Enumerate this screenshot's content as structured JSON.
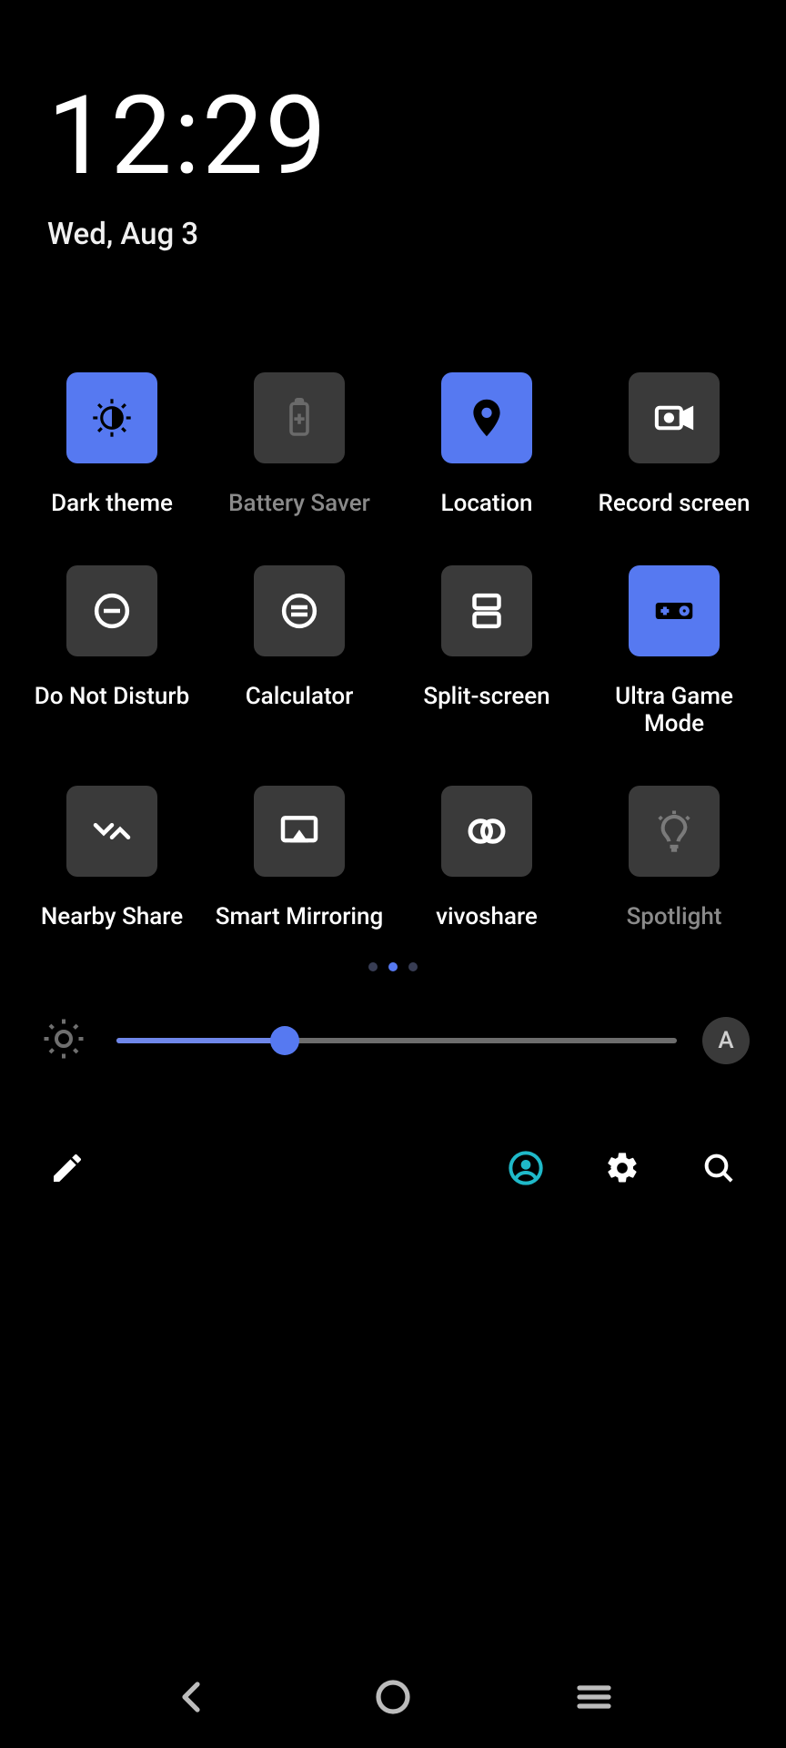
{
  "time": "12:29",
  "date": "Wed, Aug 3",
  "tiles": [
    {
      "label": "Dark theme",
      "on": true,
      "dim": false,
      "icon": "contrast"
    },
    {
      "label": "Battery Saver",
      "on": false,
      "dim": true,
      "icon": "battery"
    },
    {
      "label": "Location",
      "on": true,
      "dim": false,
      "icon": "pin"
    },
    {
      "label": "Record screen",
      "on": false,
      "dim": false,
      "icon": "camcorder"
    },
    {
      "label": "Do Not Disturb",
      "on": false,
      "dim": false,
      "icon": "dnd"
    },
    {
      "label": "Calculator",
      "on": false,
      "dim": false,
      "icon": "calc"
    },
    {
      "label": "Split-screen",
      "on": false,
      "dim": false,
      "icon": "split"
    },
    {
      "label": "Ultra Game Mode",
      "on": true,
      "dim": false,
      "icon": "game"
    },
    {
      "label": "Nearby Share",
      "on": false,
      "dim": false,
      "icon": "nearby"
    },
    {
      "label": "Smart Mirroring",
      "on": false,
      "dim": false,
      "icon": "cast"
    },
    {
      "label": "vivoshare",
      "on": false,
      "dim": false,
      "icon": "vivoshare"
    },
    {
      "label": "Spotlight",
      "on": false,
      "dim": true,
      "icon": "bulb"
    }
  ],
  "pager": {
    "count": 3,
    "active": 1
  },
  "brightness": {
    "percent": 30,
    "auto_label": "A"
  },
  "colors": {
    "accent": "#5679f1",
    "tile_off": "#3a3a3a",
    "profile_ring": "#1fb9c9"
  }
}
